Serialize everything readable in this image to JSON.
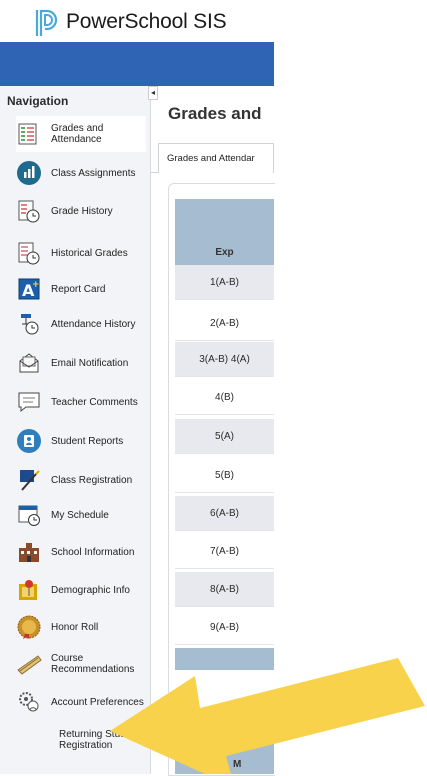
{
  "app": {
    "brand": "PowerSchool SIS"
  },
  "colors": {
    "header_blue": "#2f64b4",
    "table_header": "#a6bcd0",
    "arrow_yellow": "#f7d24a",
    "logo_blue": "#49a8dc"
  },
  "nav": {
    "title": "Navigation",
    "items": [
      {
        "label": "Grades and Attendance",
        "icon": "grades-icon"
      },
      {
        "label": "Class Assignments",
        "icon": "class-assignments-icon"
      },
      {
        "label": "Grade History",
        "icon": "grade-history-icon"
      },
      {
        "label": "Historical Grades",
        "icon": "historical-grades-icon"
      },
      {
        "label": "Report Card",
        "icon": "report-card-icon"
      },
      {
        "label": "Attendance History",
        "icon": "attendance-history-icon"
      },
      {
        "label": "Email Notification",
        "icon": "email-icon"
      },
      {
        "label": "Teacher Comments",
        "icon": "comments-icon"
      },
      {
        "label": "Student Reports",
        "icon": "student-reports-icon"
      },
      {
        "label": "Class Registration",
        "icon": "class-registration-icon"
      },
      {
        "label": "My Schedule",
        "icon": "schedule-icon"
      },
      {
        "label": "School Information",
        "icon": "school-icon"
      },
      {
        "label": "Demographic Info",
        "icon": "demographic-icon"
      },
      {
        "label": "Honor Roll",
        "icon": "honor-roll-icon"
      },
      {
        "label": "Course Recommendations",
        "icon": "course-recommendations-icon"
      },
      {
        "label": "Account Preferences",
        "icon": "account-preferences-icon"
      },
      {
        "label": "Returning Student Registration",
        "icon": ""
      }
    ]
  },
  "main": {
    "title": "Grades and",
    "tab": "Grades and Attendar",
    "table": {
      "header": "Exp",
      "rows": [
        "1(A-B)",
        "2(A-B)",
        "3(A-B) 4(A)",
        "4(B)",
        "5(A)",
        "5(B)",
        "6(A-B)",
        "7(A-B)",
        "8(A-B)",
        "9(A-B)"
      ],
      "second_header": "M"
    }
  }
}
